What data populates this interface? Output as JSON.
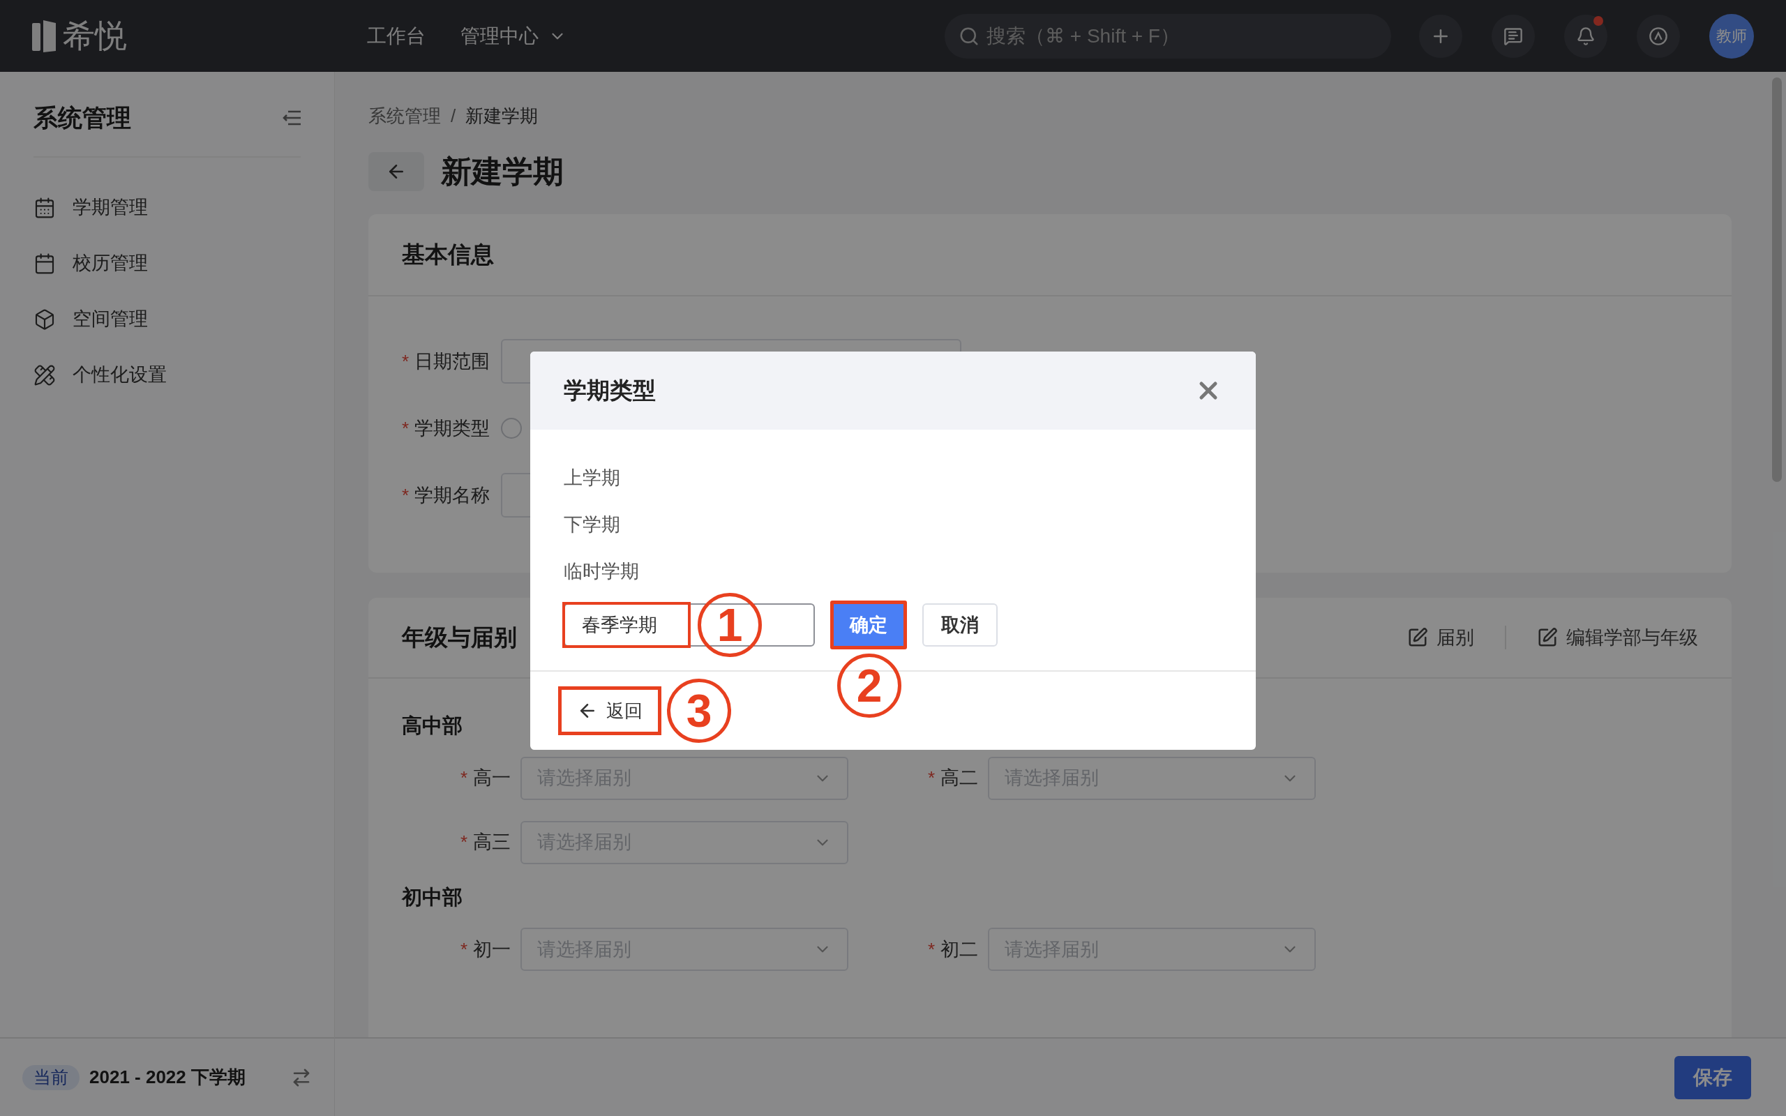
{
  "topbar": {
    "logo": "希悦",
    "nav": [
      {
        "label": "工作台",
        "has_menu": false
      },
      {
        "label": "管理中心",
        "has_menu": true
      }
    ],
    "search": {
      "placeholder": "搜索（⌘ + Shift + F）"
    },
    "notification_unread": true,
    "avatar": "教师"
  },
  "sidebar": {
    "title": "系统管理",
    "items": [
      {
        "label": "学期管理",
        "kind": "term"
      },
      {
        "label": "校历管理",
        "kind": "calendar"
      },
      {
        "label": "空间管理",
        "kind": "space"
      },
      {
        "label": "个性化设置",
        "kind": "custom"
      }
    ]
  },
  "current_term": {
    "badge": "当前",
    "label": "2021 - 2022 下学期"
  },
  "breadcrumb": {
    "items": [
      "系统管理",
      "新建学期"
    ],
    "separator": "/"
  },
  "page_title": "新建学期",
  "required_mark": "*",
  "basic_info": {
    "title": "基本信息",
    "fields": [
      {
        "label": "日期范围",
        "required": true,
        "kind": "date-range"
      },
      {
        "label": "学期类型",
        "required": true,
        "kind": "radio",
        "checked": false
      },
      {
        "label": "学期名称",
        "required": true,
        "kind": "text"
      }
    ]
  },
  "grades": {
    "title": "年级与届别",
    "actions": [
      "届别",
      "编辑学部与年级"
    ],
    "divisions": [
      {
        "name": "高中部",
        "grades": [
          {
            "label": "高一",
            "required": true,
            "placeholder": "请选择届别"
          },
          {
            "label": "高二",
            "required": true,
            "placeholder": "请选择届别"
          },
          {
            "label": "高三",
            "required": true,
            "placeholder": "请选择届别"
          }
        ]
      },
      {
        "name": "初中部",
        "grades": [
          {
            "label": "初一",
            "required": true,
            "placeholder": "请选择届别"
          },
          {
            "label": "初二",
            "required": true,
            "placeholder": "请选择届别"
          }
        ]
      }
    ]
  },
  "dialog": {
    "title": "学期类型",
    "options": [
      "上学期",
      "下学期",
      "临时学期"
    ],
    "input": {
      "value": "春季学期",
      "highlighted": true,
      "step": "1"
    },
    "confirm": {
      "label": "确定",
      "highlighted": true,
      "step": "2"
    },
    "cancel": {
      "label": "取消",
      "highlighted": false
    },
    "back": {
      "label": "返回",
      "highlighted": true,
      "step": "3"
    }
  },
  "save_button": "保存"
}
